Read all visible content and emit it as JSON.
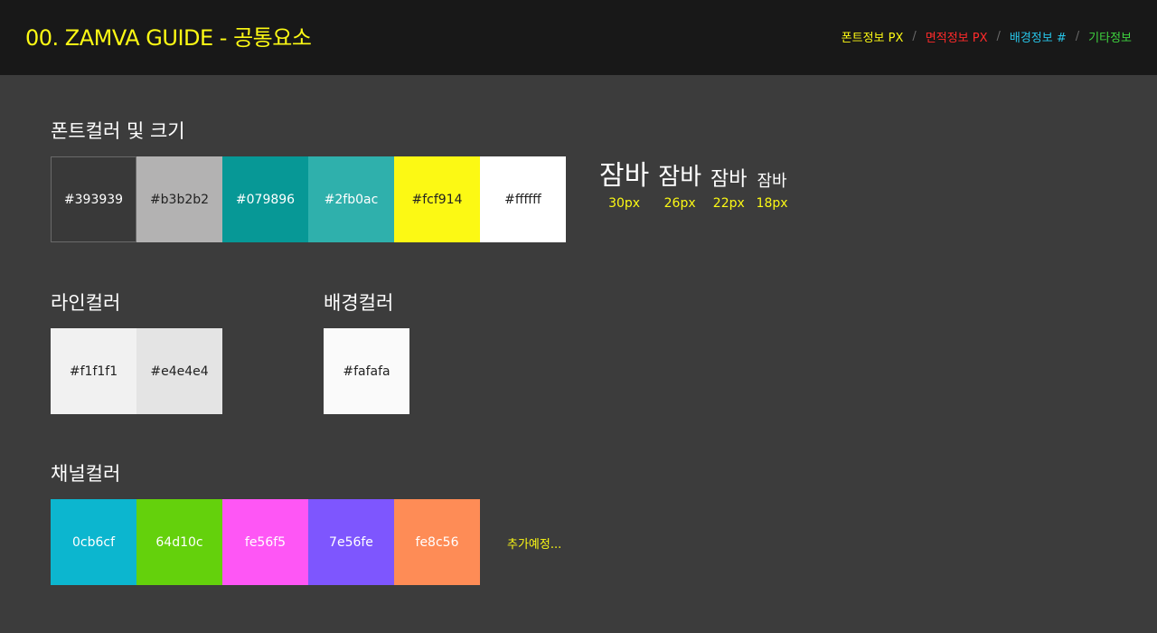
{
  "header": {
    "title": "00. ZAMVA GUIDE - 공통요소",
    "nav": [
      {
        "label": "폰트정보 PX",
        "color": "#fcf914"
      },
      {
        "label": "면적정보 PX",
        "color": "#ff2a2a"
      },
      {
        "label": "배경정보 #",
        "color": "#27c4e8"
      },
      {
        "label": "기타정보",
        "color": "#3fd43f"
      }
    ],
    "separator": "/"
  },
  "font_colors": {
    "title": "폰트컬러 및 크기",
    "swatches": [
      {
        "label": "#393939",
        "color": "#393939",
        "text_color": "#ffffff"
      },
      {
        "label": "#b3b2b2",
        "color": "#b3b2b2",
        "text_color": "#222222"
      },
      {
        "label": "#079896",
        "color": "#079896",
        "text_color": "#ffffff"
      },
      {
        "label": "#2fb0ac",
        "color": "#2fb0ac",
        "text_color": "#ffffff"
      },
      {
        "label": "#fcf914",
        "color": "#fcf914",
        "text_color": "#222222"
      },
      {
        "label": "#ffffff",
        "color": "#ffffff",
        "text_color": "#222222"
      }
    ],
    "sizes": [
      {
        "sample": "잠바",
        "size_label": "30px"
      },
      {
        "sample": "잠바",
        "size_label": "26px"
      },
      {
        "sample": "잠바",
        "size_label": "22px"
      },
      {
        "sample": "잠바",
        "size_label": "18px"
      }
    ]
  },
  "line_colors": {
    "title": "라인컬러",
    "swatches": [
      {
        "label": "#f1f1f1",
        "color": "#f1f1f1",
        "text_color": "#222222"
      },
      {
        "label": "#e4e4e4",
        "color": "#e4e4e4",
        "text_color": "#222222"
      }
    ]
  },
  "bg_colors": {
    "title": "배경컬러",
    "swatches": [
      {
        "label": "#fafafa",
        "color": "#fafafa",
        "text_color": "#222222"
      }
    ]
  },
  "channel_colors": {
    "title": "채널컬러",
    "swatches": [
      {
        "label": "0cb6cf",
        "color": "#0cb6cf",
        "text_color": "#ffffff"
      },
      {
        "label": "64d10c",
        "color": "#64d10c",
        "text_color": "#ffffff"
      },
      {
        "label": "fe56f5",
        "color": "#fe56f5",
        "text_color": "#ffffff"
      },
      {
        "label": "7e56fe",
        "color": "#7e56fe",
        "text_color": "#ffffff"
      },
      {
        "label": "fe8c56",
        "color": "#fe8c56",
        "text_color": "#ffffff"
      }
    ],
    "more_label": "추가예정..."
  }
}
